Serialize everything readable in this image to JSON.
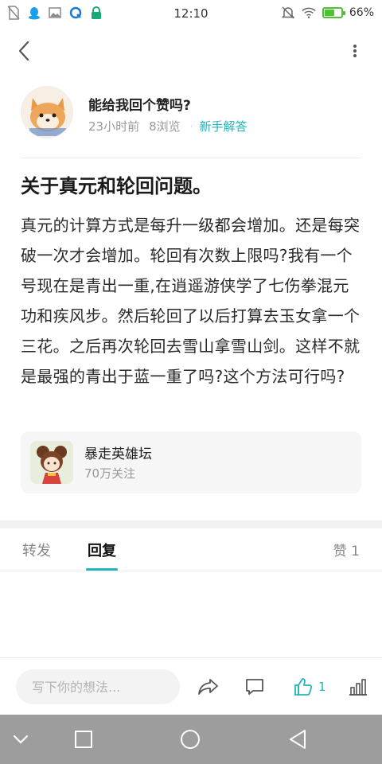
{
  "status_bar": {
    "time": "12:10",
    "battery_text": "66%",
    "battery_level": 0.66,
    "left_icons": [
      "sim-off-icon",
      "qq-icon",
      "image-icon",
      "app-icon",
      "lock-icon"
    ],
    "right_icons": [
      "mute-icon",
      "wifi-icon",
      "battery-icon"
    ]
  },
  "author": {
    "name": "能给我回个赞吗?",
    "time_ago": "23小时前",
    "views": "8浏览",
    "separator": "·",
    "tag": "新手解答"
  },
  "post": {
    "title": "关于真元和轮回问题。",
    "body": "真元的计算方式是每升一级都会增加。还是每突破一次才会增加。轮回有次数上限吗?我有一个号现在是青出一重,在逍遥游侠学了七伤拳混元功和疾风步。然后轮回了以后打算去玉女拿一个三花。之后再次轮回去雪山拿雪山剑。这样不就是最强的青出于蓝一重了吗?这个方法可行吗?"
  },
  "forum": {
    "name": "暴走英雄坛",
    "followers": "70万关注"
  },
  "tabs": {
    "forward": "转发",
    "reply": "回复",
    "likes": "赞 1"
  },
  "action_bar": {
    "input_placeholder": "写下你的想法...",
    "like_count": "1"
  },
  "colors": {
    "accent": "#22b6b8",
    "battery": "#4dc232",
    "nav_bar": "#9d9d9d"
  }
}
